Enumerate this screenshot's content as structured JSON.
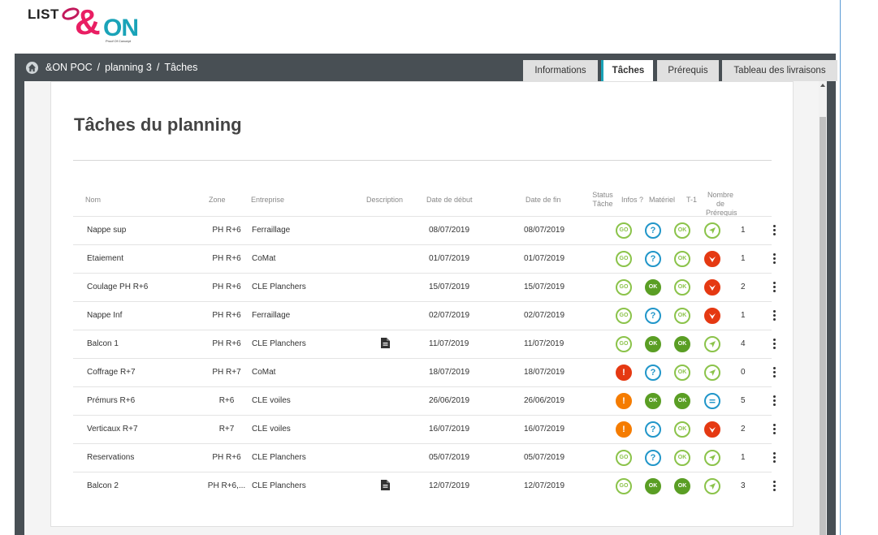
{
  "logo": {
    "list": "LIST",
    "amp": "&",
    "on": "ON",
    "tagline": "Proof Of Concept"
  },
  "breadcrumb": [
    "&ON POC",
    "planning 3",
    "Tâches"
  ],
  "tabs": [
    "Informations",
    "Tâches",
    "Prérequis",
    "Tableau des livraisons"
  ],
  "active_tab": "Tâches",
  "page_title": "Tâches du planning",
  "columns": {
    "nom": "Nom",
    "zone": "Zone",
    "entreprise": "Entreprise",
    "description": "Description",
    "debut": "Date de début",
    "fin": "Date de fin",
    "status_1": "Status",
    "status_2": "Tâche",
    "infos": "Infos ?",
    "materiel": "Matériel",
    "t1": "T-1",
    "prereq_1": "Nombre de",
    "prereq_2": "Prérequis"
  },
  "rows": [
    {
      "nom": "Nappe sup",
      "zone": "PH R+6",
      "entreprise": "Ferraillage",
      "has_doc": false,
      "debut": "08/07/2019",
      "fin": "08/07/2019",
      "status": "go",
      "infos": "question",
      "materiel": "ok-outline",
      "t1": "arrow",
      "prereq": "1"
    },
    {
      "nom": "Etaiement",
      "zone": "PH R+6",
      "entreprise": "CoMat",
      "has_doc": false,
      "debut": "01/07/2019",
      "fin": "01/07/2019",
      "status": "go",
      "infos": "question",
      "materiel": "ok-outline",
      "t1": "down",
      "prereq": "1"
    },
    {
      "nom": "Coulage PH R+6",
      "zone": "PH R+6",
      "entreprise": "CLE Planchers",
      "has_doc": false,
      "debut": "15/07/2019",
      "fin": "15/07/2019",
      "status": "go",
      "infos": "ok-filled",
      "materiel": "ok-outline",
      "t1": "down",
      "prereq": "2"
    },
    {
      "nom": "Nappe Inf",
      "zone": "PH R+6",
      "entreprise": "Ferraillage",
      "has_doc": false,
      "debut": "02/07/2019",
      "fin": "02/07/2019",
      "status": "go",
      "infos": "question",
      "materiel": "ok-outline",
      "t1": "down",
      "prereq": "1"
    },
    {
      "nom": "Balcon 1",
      "zone": "PH R+6",
      "entreprise": "CLE Planchers",
      "has_doc": true,
      "debut": "11/07/2019",
      "fin": "11/07/2019",
      "status": "go",
      "infos": "ok-filled",
      "materiel": "ok-filled",
      "t1": "arrow",
      "prereq": "4"
    },
    {
      "nom": "Coffrage R+7",
      "zone": "PH R+7",
      "entreprise": "CoMat",
      "has_doc": false,
      "debut": "18/07/2019",
      "fin": "18/07/2019",
      "status": "warn-red",
      "infos": "question",
      "materiel": "ok-outline",
      "t1": "arrow",
      "prereq": "0"
    },
    {
      "nom": "Prémurs R+6",
      "zone": "R+6",
      "entreprise": "CLE voiles",
      "has_doc": false,
      "debut": "26/06/2019",
      "fin": "26/06/2019",
      "status": "warn-orange",
      "infos": "ok-filled",
      "materiel": "ok-filled",
      "t1": "equal",
      "prereq": "5"
    },
    {
      "nom": "Verticaux R+7",
      "zone": "R+7",
      "entreprise": "CLE voiles",
      "has_doc": false,
      "debut": "16/07/2019",
      "fin": "16/07/2019",
      "status": "warn-orange",
      "infos": "question",
      "materiel": "ok-outline",
      "t1": "down",
      "prereq": "2"
    },
    {
      "nom": "Reservations",
      "zone": "PH R+6",
      "entreprise": "CLE Planchers",
      "has_doc": false,
      "debut": "05/07/2019",
      "fin": "05/07/2019",
      "status": "go",
      "infos": "question",
      "materiel": "ok-outline",
      "t1": "arrow",
      "prereq": "1"
    },
    {
      "nom": "Balcon 2",
      "zone": "PH R+6,...",
      "entreprise": "CLE Planchers",
      "has_doc": true,
      "debut": "12/07/2019",
      "fin": "12/07/2019",
      "status": "go",
      "infos": "ok-filled",
      "materiel": "ok-filled",
      "t1": "arrow",
      "prereq": "3"
    }
  ],
  "badge_text": {
    "go": "GO",
    "ok": "OK",
    "question": "?",
    "warn": "!"
  },
  "colors": {
    "accent": "#1aa3b8",
    "green": "#8bc34a",
    "green_dark": "#5a9e24",
    "blue": "#2196c9",
    "red": "#e53912",
    "orange": "#f57c00"
  }
}
